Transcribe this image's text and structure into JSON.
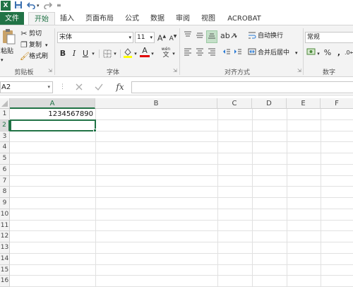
{
  "titlebar": {
    "logo": "X",
    "save_icon": "save-icon",
    "undo_icon": "undo-icon",
    "redo_icon": "redo-icon",
    "customize_icon": "customize-qat-icon"
  },
  "tabs": [
    "文件",
    "开始",
    "插入",
    "页面布局",
    "公式",
    "数据",
    "审阅",
    "视图",
    "ACROBAT"
  ],
  "ribbon": {
    "clipboard": {
      "paste": "粘贴",
      "cut": "剪切",
      "copy": "复制",
      "format_painter": "格式刷",
      "label": "剪贴板"
    },
    "font": {
      "font_name": "宋体",
      "font_size": "11",
      "grow": "A",
      "shrink": "A",
      "bold": "B",
      "italic": "I",
      "underline": "U",
      "font_color_glyph": "A",
      "label": "字体"
    },
    "alignment": {
      "wrap_text": "自动换行",
      "merge_center": "合并后居中",
      "label": "对齐方式"
    },
    "number": {
      "format": "常规",
      "percent": "%",
      "comma": ",",
      "label": "数字"
    }
  },
  "formula_bar": {
    "name_box": "A2",
    "fx": "fx",
    "content": ""
  },
  "grid": {
    "columns": [
      "A",
      "B",
      "C",
      "D",
      "E",
      "F"
    ],
    "rows": [
      "1",
      "2",
      "3",
      "4",
      "5",
      "6",
      "7",
      "8",
      "9",
      "10",
      "11",
      "12",
      "13",
      "14",
      "15",
      "16"
    ],
    "cells": {
      "A1": "1234567890"
    },
    "selected_cell": "A2"
  },
  "colors": {
    "excel_green": "#217346",
    "font_color_red": "#e00000",
    "fill_yellow": "#ffff00"
  }
}
